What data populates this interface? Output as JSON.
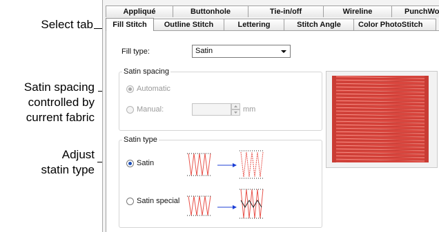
{
  "callouts": {
    "select_tab": "Select tab",
    "satin_spacing": [
      "Satin spacing",
      "controlled by",
      "current fabric"
    ],
    "adjust_type": [
      "Adjust",
      "statin type"
    ]
  },
  "tabs_row1": [
    "Appliqué",
    "Buttonhole",
    "Tie-in/off",
    "Wireline",
    "PunchWork"
  ],
  "tabs_row2": [
    "Fill Stitch",
    "Outline Stitch",
    "Lettering",
    "Stitch Angle",
    "Color PhotoStitch"
  ],
  "active_tab": "Fill Stitch",
  "fill_type": {
    "label": "Fill type:",
    "value": "Satin"
  },
  "satin_spacing": {
    "title": "Satin spacing",
    "automatic_label": "Automatic",
    "manual_label": "Manual:",
    "manual_value": "",
    "unit": "mm",
    "selected": "Automatic",
    "enabled": false
  },
  "satin_type": {
    "title": "Satin type",
    "options": [
      "Satin",
      "Satin special"
    ],
    "selected": "Satin"
  },
  "colors": {
    "stitch_red": "#e8524a",
    "arrow_blue": "#1c3fd6",
    "radio_dot": "#1c4fb8",
    "preview_red": "#d9463e"
  },
  "icons": {
    "satin_diagram": "zigzag-stitch-icon",
    "arrow": "arrow-right-icon",
    "preview": "satin-stitch-preview"
  }
}
